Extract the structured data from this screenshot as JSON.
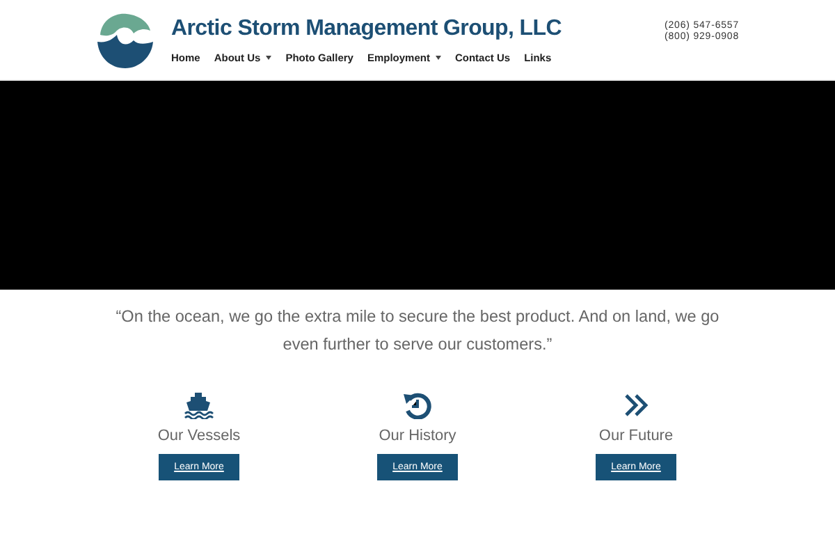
{
  "header": {
    "site_title": "Arctic Storm Management Group, LLC",
    "nav": [
      {
        "label": "Home",
        "has_dropdown": false
      },
      {
        "label": "About Us",
        "has_dropdown": true
      },
      {
        "label": "Photo Gallery",
        "has_dropdown": false
      },
      {
        "label": "Employment",
        "has_dropdown": true
      },
      {
        "label": "Contact Us",
        "has_dropdown": false
      },
      {
        "label": "Links",
        "has_dropdown": false
      }
    ],
    "phones": [
      "(206) 547-6557",
      "(800) 929-0908"
    ]
  },
  "quote": "“On the ocean, we go the extra mile to secure the best product. And on land, we go even further to serve our customers.”",
  "features": [
    {
      "kind": "ship",
      "title": "Our Vessels",
      "button": "Learn More"
    },
    {
      "kind": "history",
      "title": "Our History",
      "button": "Learn More"
    },
    {
      "kind": "chevrons",
      "title": "Our Future",
      "button": "Learn More"
    }
  ]
}
